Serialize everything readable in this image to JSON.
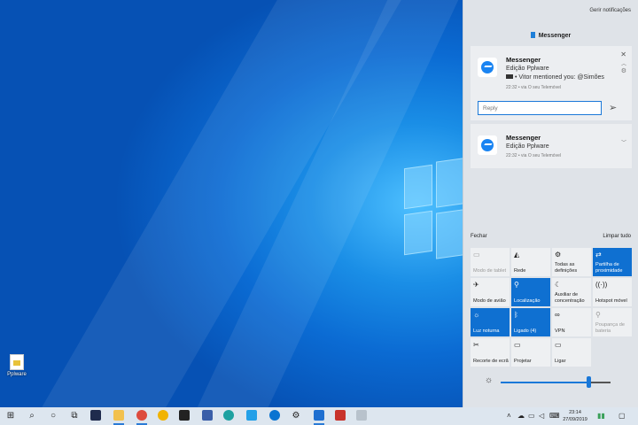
{
  "desktop": {
    "icon_label": "Pplware"
  },
  "action_center": {
    "manage_label": "Gerir notificações",
    "group_title": "Messenger",
    "notifications": [
      {
        "title": "Messenger",
        "subtitle": "Edição Pplware",
        "message": "• Vitor mentioned you: @Simões",
        "time": "22:32 • via O seu Telemóvel",
        "reply_placeholder": "Reply"
      },
      {
        "title": "Messenger",
        "subtitle": "Edição Pplware",
        "time": "22:32 • via O seu Telemóvel"
      }
    ],
    "collapse_label": "Fechar",
    "clear_label": "Limpar tudo",
    "tiles": [
      {
        "label": "Modo de tablet",
        "icon": "▭",
        "state": "dim"
      },
      {
        "label": "Rede",
        "icon": "◭",
        "state": "off"
      },
      {
        "label": "Todas as definições",
        "icon": "⚙",
        "state": "off"
      },
      {
        "label": "Partilha de proximidade",
        "icon": "⇄",
        "state": "on"
      },
      {
        "label": "Modo de avião",
        "icon": "✈",
        "state": "off"
      },
      {
        "label": "Localização",
        "icon": "⚲",
        "state": "on"
      },
      {
        "label": "Auxiliar de concentração",
        "icon": "☾",
        "state": "off"
      },
      {
        "label": "Hotspot móvel",
        "icon": "((·))",
        "state": "off"
      },
      {
        "label": "Luz noturna",
        "icon": "☼",
        "state": "on"
      },
      {
        "label": "Ligado (4)",
        "icon": "ᛒ",
        "state": "on"
      },
      {
        "label": "VPN",
        "icon": "∞",
        "state": "off"
      },
      {
        "label": "Poupança de bateria",
        "icon": "⚲",
        "state": "dim"
      },
      {
        "label": "Recorte de ecrã",
        "icon": "✂",
        "state": "off"
      },
      {
        "label": "Projetar",
        "icon": "▭",
        "state": "off"
      },
      {
        "label": "Ligar",
        "icon": "▭",
        "state": "off"
      }
    ],
    "brightness_level": 0.8
  },
  "taskbar": {
    "time": "23:14",
    "date": "27/09/2019"
  }
}
